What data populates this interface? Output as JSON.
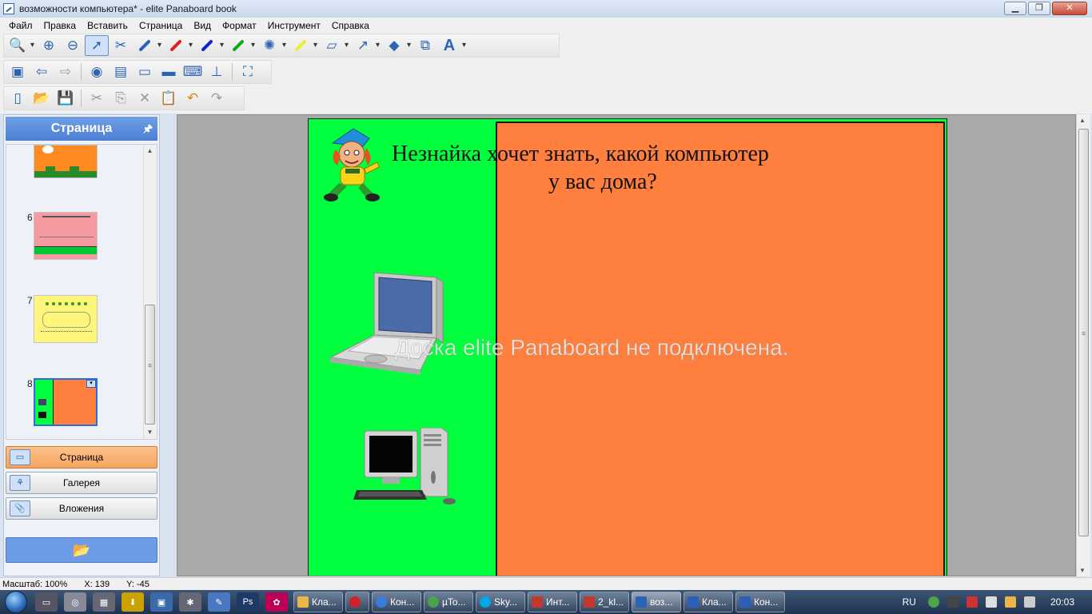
{
  "window": {
    "title": "возможности компьютера* - elite Panaboard book",
    "controls": {
      "minimize": "▁",
      "maximize": "❐",
      "close": "✕"
    }
  },
  "menu": [
    "Файл",
    "Правка",
    "Вставить",
    "Страница",
    "Вид",
    "Формат",
    "Инструмент",
    "Справка"
  ],
  "left_panel": {
    "header": "Страница",
    "pin_icon": "pin-icon",
    "pages": [
      {
        "number": "",
        "theme": "orange-bricks"
      },
      {
        "number": "6",
        "theme": "pink-table"
      },
      {
        "number": "7",
        "theme": "yellow-maze"
      },
      {
        "number": "8",
        "theme": "green-orange",
        "selected": true
      }
    ],
    "buttons": [
      {
        "label": "Страница",
        "icon": "page-icon",
        "active": true
      },
      {
        "label": "Галерея",
        "icon": "gallery-icon"
      },
      {
        "label": "Вложения",
        "icon": "attachment-icon"
      }
    ],
    "bottom_button_icon": "folder-open-icon"
  },
  "canvas": {
    "title_line1": "Незнайка хочет знать, какой компьютер",
    "title_line2": "у вас дома?",
    "watermark": "Доска elite Panaboard не подключена.",
    "colors": {
      "left_bg": "#00ff3c",
      "right_bg": "#ff7f3f"
    }
  },
  "status": {
    "zoom": "Масштаб: 100%",
    "x": "X: 139",
    "y": "Y: -45"
  },
  "taskbar": {
    "tasks": [
      {
        "label": "Кла...",
        "color": "#e8b64a"
      },
      {
        "label": "",
        "color": "#d0212a"
      },
      {
        "label": "Кон...",
        "color": "#3a7be0"
      },
      {
        "label": "µTo...",
        "color": "#4aa54a"
      },
      {
        "label": "Sky...",
        "color": "#00a8e8"
      },
      {
        "label": "Инт...",
        "color": "#c0392b"
      },
      {
        "label": "2_kl...",
        "color": "#c0392b"
      },
      {
        "label": "воз...",
        "color": "#2d63b4",
        "active": true
      },
      {
        "label": "Кла...",
        "color": "#2b5fb8"
      },
      {
        "label": "Кон...",
        "color": "#2b5fb8"
      }
    ],
    "language": "RU",
    "clock": "20:03"
  }
}
